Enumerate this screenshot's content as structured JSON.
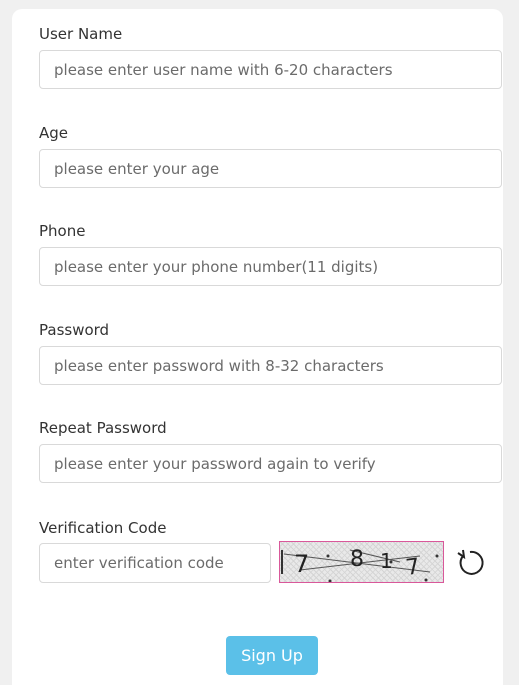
{
  "form": {
    "username": {
      "label": "User Name",
      "placeholder": "please enter user name with 6-20 characters",
      "value": ""
    },
    "age": {
      "label": "Age",
      "placeholder": "please enter your age",
      "value": ""
    },
    "phone": {
      "label": "Phone",
      "placeholder": "please enter your phone number(11 digits)",
      "value": ""
    },
    "password": {
      "label": "Password",
      "placeholder": "please enter password with 8-32 characters",
      "value": ""
    },
    "repeat_password": {
      "label": "Repeat Password",
      "placeholder": "please enter your password again to verify",
      "value": ""
    },
    "verification": {
      "label": "Verification Code",
      "placeholder": "enter verification code",
      "value": "",
      "captcha_chars": [
        "7",
        "8",
        "1",
        "7"
      ],
      "captcha_border_color": "#d9589a",
      "refresh_icon": "refresh-icon"
    },
    "submit_label": "Sign Up",
    "submit_color": "#5bc0e8"
  }
}
